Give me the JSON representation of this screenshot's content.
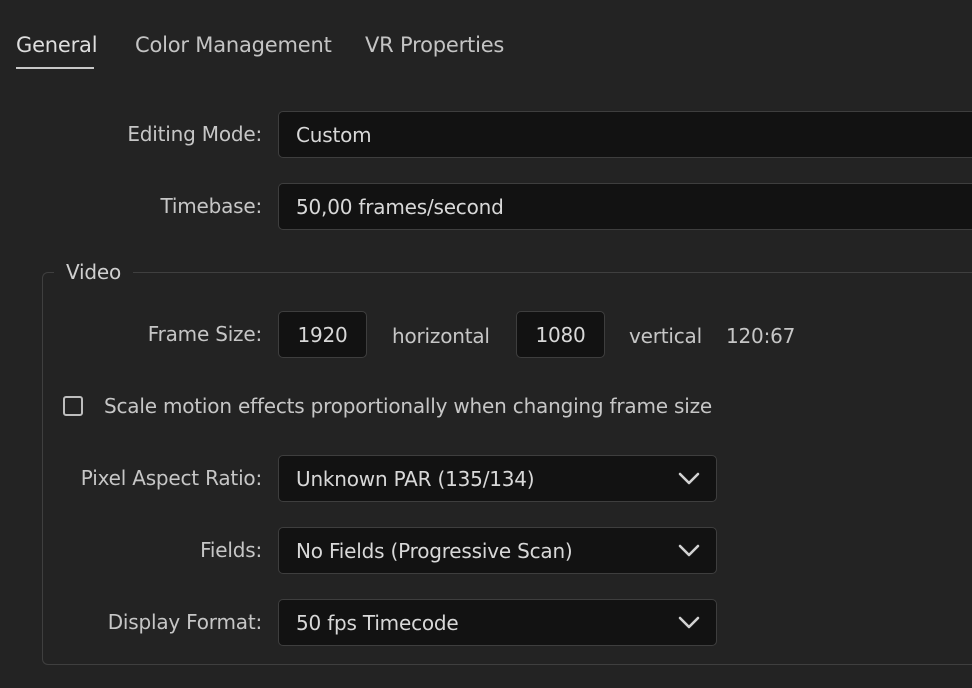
{
  "tabs": [
    {
      "label": "General",
      "active": true
    },
    {
      "label": "Color Management",
      "active": false
    },
    {
      "label": "VR Properties",
      "active": false
    }
  ],
  "editing_mode": {
    "label": "Editing Mode:",
    "value": "Custom"
  },
  "timebase": {
    "label": "Timebase:",
    "value": "50,00  frames/second"
  },
  "video": {
    "title": "Video",
    "frame_size": {
      "label": "Frame Size:",
      "width": "1920",
      "horizontal_label": "horizontal",
      "height": "1080",
      "vertical_label": "vertical",
      "ratio": "120:67"
    },
    "scale_checkbox": {
      "label": "Scale motion effects proportionally when changing frame size",
      "checked": false
    },
    "pixel_aspect_ratio": {
      "label": "Pixel Aspect Ratio:",
      "value": "Unknown PAR (135/134)"
    },
    "fields": {
      "label": "Fields:",
      "value": "No Fields (Progressive Scan)"
    },
    "display_format": {
      "label": "Display Format:",
      "value": "50 fps Timecode"
    }
  },
  "icons": {
    "dropdown": "chevron-down-icon"
  }
}
